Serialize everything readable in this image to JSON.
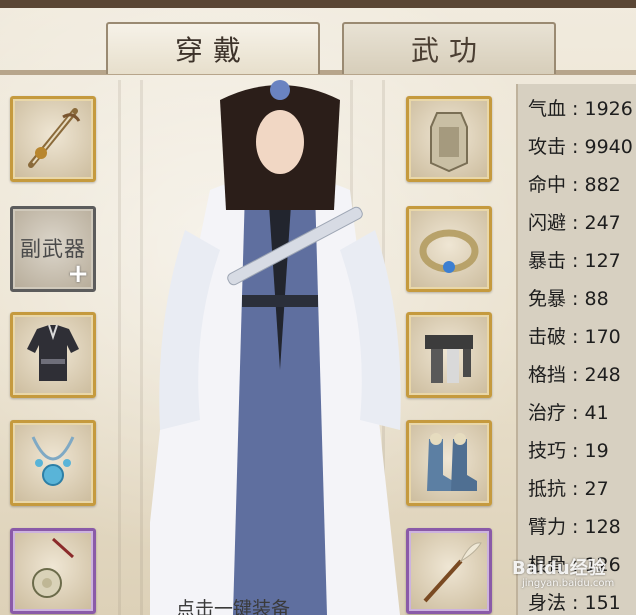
{
  "tabs": [
    {
      "label": "穿戴"
    },
    {
      "label": "武功"
    }
  ],
  "left_slots": [
    {
      "name": "weapon-slot",
      "icon": "sword-icon"
    },
    {
      "name": "offhand-weapon-slot",
      "label": "副武器",
      "plus": "+",
      "icon": "plus-icon"
    },
    {
      "name": "armor-slot",
      "icon": "robe-icon"
    },
    {
      "name": "necklace-slot",
      "icon": "necklace-icon"
    },
    {
      "name": "jade-pendant-slot",
      "icon": "pendant-icon"
    }
  ],
  "right_slots": [
    {
      "name": "shoulder-armor-slot",
      "icon": "vest-icon"
    },
    {
      "name": "ring-slot",
      "icon": "bracelet-icon"
    },
    {
      "name": "belt-slot",
      "icon": "belt-icon"
    },
    {
      "name": "boots-slot",
      "icon": "boots-icon"
    },
    {
      "name": "whisk-slot",
      "icon": "whisk-icon"
    }
  ],
  "stats": [
    {
      "label": "气血",
      "value": "1926"
    },
    {
      "label": "攻击",
      "value": "9940"
    },
    {
      "label": "命中",
      "value": "882"
    },
    {
      "label": "闪避",
      "value": "247"
    },
    {
      "label": "暴击",
      "value": "127"
    },
    {
      "label": "免暴",
      "value": "88"
    },
    {
      "label": "击破",
      "value": "170"
    },
    {
      "label": "格挡",
      "value": "248"
    },
    {
      "label": "治疗",
      "value": "41"
    },
    {
      "label": "技巧",
      "value": "19"
    },
    {
      "label": "抵抗",
      "value": "27"
    },
    {
      "label": "臂力",
      "value": "128"
    },
    {
      "label": "根骨",
      "value": "126"
    },
    {
      "label": "身法",
      "value": "151"
    }
  ],
  "hint": "点击一键装备",
  "watermark": {
    "text": "Baidu经验",
    "url": "jingyan.baidu.com"
  },
  "colors": {
    "gold_border": "#c59a3e",
    "purple_border": "#8a5aa8",
    "stat_panel": "#d7d0c1"
  }
}
